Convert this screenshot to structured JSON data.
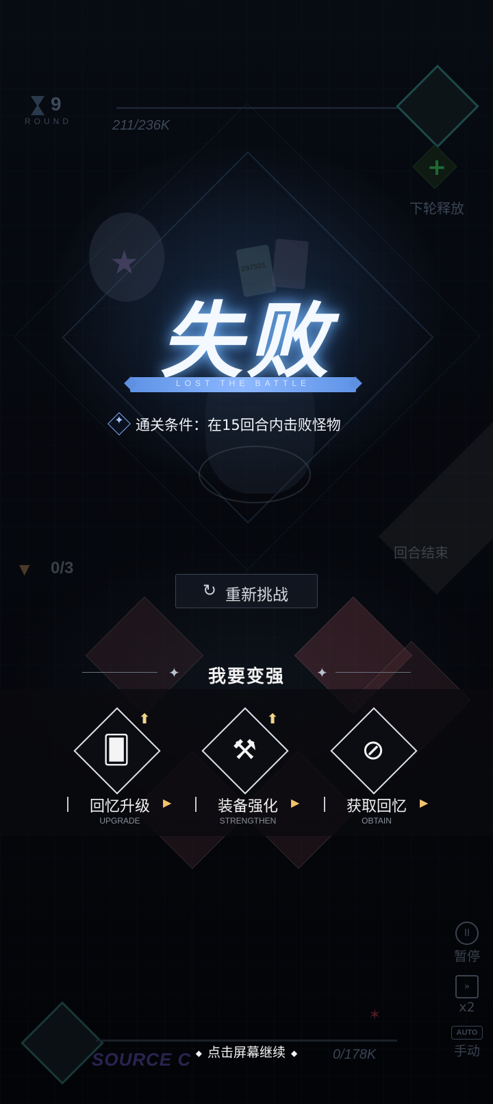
{
  "hud": {
    "round_number": "9",
    "round_label": "ROUND",
    "enemy_hp": "211/236K",
    "next_release_label": "下轮释放",
    "plus_icon": "plus-icon",
    "hourglass_icon": "hourglass-icon"
  },
  "result": {
    "title": "失败",
    "subtitle": "LOST THE BATTLE",
    "condition_text": "通关条件：在15回合内击败怪物",
    "condition_icon": "sparkle-diamond-icon"
  },
  "background": {
    "card_number": "297501",
    "star_glyph": "★"
  },
  "side": {
    "counter": "0/3",
    "end_turn_label": "回合结束"
  },
  "retry": {
    "label": "重新挑战",
    "icon": "↻"
  },
  "get_stronger": {
    "title": "我要变强",
    "options": [
      {
        "name": "upgrade",
        "label": "回忆升级",
        "sub": "UPGRADE",
        "glyph": "🂠",
        "has_up_arrow": true
      },
      {
        "name": "strengthen",
        "label": "装备强化",
        "sub": "STRENGTHEN",
        "glyph": "⚒",
        "has_up_arrow": true
      },
      {
        "name": "obtain",
        "label": "获取回忆",
        "sub": "OBTAIN",
        "glyph": "⊘",
        "has_up_arrow": false
      }
    ],
    "up_arrow": "⬆",
    "chevron": "▶"
  },
  "controls": {
    "pause_label": "暂停",
    "pause_icon": "II",
    "speed_label": "x2",
    "speed_icon": "»",
    "auto_badge": "AUTO",
    "manual_label": "手动"
  },
  "bottom": {
    "source_text": "SOURCE C",
    "player_hp": "0/178K",
    "tap_continue": "点击屏幕继续",
    "dot": "◆"
  },
  "colors": {
    "title_glow": "#78beff",
    "banner": "#8db8ff",
    "up_arrow": "#f3d48c",
    "chevron": "#f3c36c"
  }
}
